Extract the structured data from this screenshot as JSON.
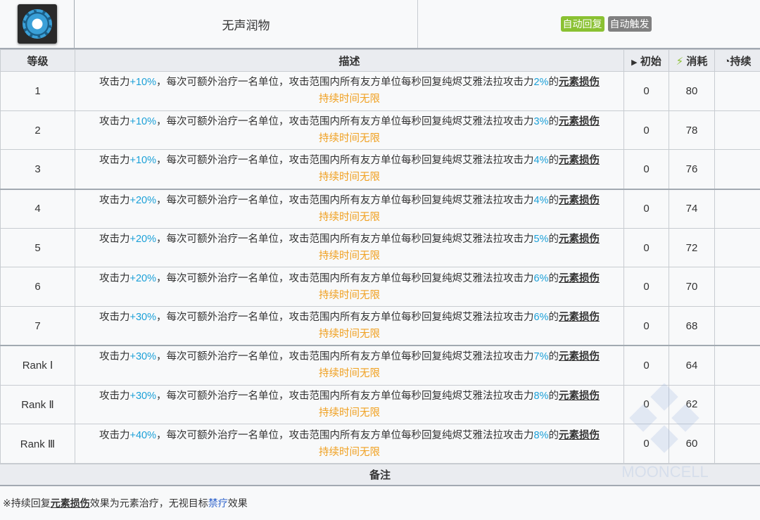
{
  "skill": {
    "name": "无声润物",
    "tags": [
      {
        "label": "自动回复",
        "color": "#8ac132"
      },
      {
        "label": "自动触发",
        "color": "#808080"
      }
    ]
  },
  "headers": {
    "level": "等级",
    "desc": "描述",
    "initial": "初始",
    "cost": "消耗",
    "duration": "持续"
  },
  "desc_parts": {
    "a": "攻击力",
    "b": "，每次可额外治疗一名单位，攻击范围内所有友方单位每秒回复纯烬艾雅法拉攻击力",
    "c": "的",
    "d": "元素损伤",
    "e": "持续时间无限"
  },
  "rows": [
    {
      "level": "1",
      "atk": "+10%",
      "pct": "2%",
      "initial": "0",
      "cost": "80",
      "duration": ""
    },
    {
      "level": "2",
      "atk": "+10%",
      "pct": "3%",
      "initial": "0",
      "cost": "78",
      "duration": ""
    },
    {
      "level": "3",
      "atk": "+10%",
      "pct": "4%",
      "initial": "0",
      "cost": "76",
      "duration": ""
    },
    {
      "level": "4",
      "atk": "+20%",
      "pct": "4%",
      "initial": "0",
      "cost": "74",
      "duration": ""
    },
    {
      "level": "5",
      "atk": "+20%",
      "pct": "5%",
      "initial": "0",
      "cost": "72",
      "duration": ""
    },
    {
      "level": "6",
      "atk": "+20%",
      "pct": "6%",
      "initial": "0",
      "cost": "70",
      "duration": ""
    },
    {
      "level": "7",
      "atk": "+30%",
      "pct": "6%",
      "initial": "0",
      "cost": "68",
      "duration": ""
    },
    {
      "level": "Rank Ⅰ",
      "atk": "+30%",
      "pct": "7%",
      "initial": "0",
      "cost": "64",
      "duration": ""
    },
    {
      "level": "Rank Ⅱ",
      "atk": "+30%",
      "pct": "8%",
      "initial": "0",
      "cost": "62",
      "duration": ""
    },
    {
      "level": "Rank Ⅲ",
      "atk": "+40%",
      "pct": "8%",
      "initial": "0",
      "cost": "60",
      "duration": ""
    }
  ],
  "notes": {
    "title": "备注",
    "p1": "※持续回复",
    "p2": "元素损伤",
    "p3": "效果为元素治疗，无视目标",
    "p4": "禁疗",
    "p5": "效果"
  },
  "watermark": "MOONCELL"
}
